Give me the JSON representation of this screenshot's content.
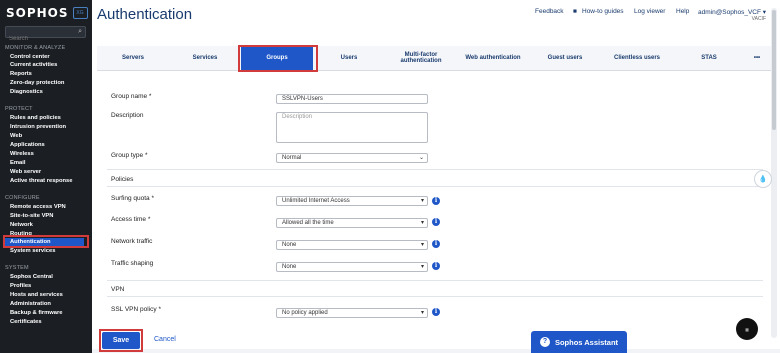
{
  "brand": {
    "logo_text": "SOPHOS",
    "badge_text": "XG"
  },
  "sidebar": {
    "search_placeholder": "Search",
    "sections": [
      {
        "title": "MONITOR & ANALYZE",
        "items": [
          "Control center",
          "Current activities",
          "Reports",
          "Zero-day protection",
          "Diagnostics"
        ]
      },
      {
        "title": "PROTECT",
        "items": [
          "Rules and policies",
          "Intrusion prevention",
          "Web",
          "Applications",
          "Wireless",
          "Email",
          "Web server",
          "Active threat response"
        ]
      },
      {
        "title": "CONFIGURE",
        "items": [
          "Remote access VPN",
          "Site-to-site VPN",
          "Network",
          "Routing",
          "Authentication",
          "System services"
        ]
      },
      {
        "title": "SYSTEM",
        "items": [
          "Sophos Central",
          "Profiles",
          "Hosts and services",
          "Administration",
          "Backup & firmware",
          "Certificates"
        ]
      }
    ],
    "active_item": "Authentication"
  },
  "header": {
    "title": "Authentication",
    "links": [
      "Feedback",
      "How-to guides",
      "Log viewer",
      "Help"
    ],
    "user": "admin@Sophos_VCF",
    "user_sub": "VACIF"
  },
  "tabs": [
    "Servers",
    "Services",
    "Groups",
    "Users",
    "Multi-factor authentication",
    "Web authentication",
    "Guest users",
    "Clientless users",
    "STAS",
    "•••"
  ],
  "active_tab": "Groups",
  "form": {
    "group_name_label": "Group name *",
    "group_name_value": "SSLVPN-Users",
    "description_label": "Description",
    "description_placeholder": "Description",
    "group_type_label": "Group type *",
    "group_type_value": "Normal",
    "policies_heading": "Policies",
    "surfing_quota_label": "Surfing quota *",
    "surfing_quota_value": "Unlimited Internet Access",
    "access_time_label": "Access time *",
    "access_time_value": "Allowed all the time",
    "network_traffic_label": "Network traffic",
    "network_traffic_value": "None",
    "traffic_shaping_label": "Traffic shaping",
    "traffic_shaping_value": "None",
    "vpn_heading": "VPN",
    "ssl_vpn_label": "SSL VPN policy *",
    "ssl_vpn_value": "No policy applied"
  },
  "actions": {
    "save": "Save",
    "cancel": "Cancel"
  },
  "assistant": {
    "label": "Sophos Assistant"
  },
  "accent_color": "#1f57c8",
  "highlight_color": "#d23b3b"
}
